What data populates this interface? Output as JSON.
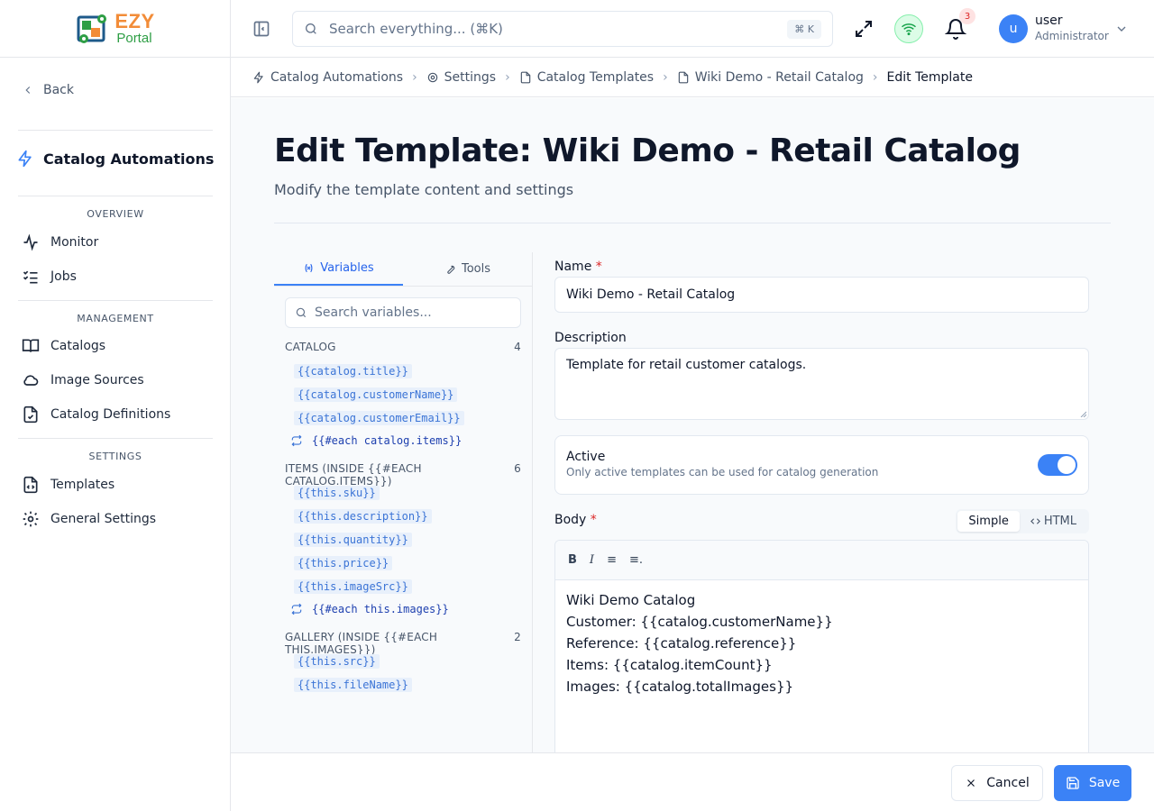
{
  "brand": {
    "line1": "EZY",
    "line2": "Portal"
  },
  "sidebar": {
    "back_label": "Back",
    "app_title": "Catalog Automations",
    "sections": [
      {
        "title": "OVERVIEW",
        "items": [
          {
            "label": "Monitor",
            "icon": "activity-icon"
          },
          {
            "label": "Jobs",
            "icon": "list-checks-icon"
          }
        ]
      },
      {
        "title": "MANAGEMENT",
        "items": [
          {
            "label": "Catalogs",
            "icon": "book-open-icon"
          },
          {
            "label": "Image Sources",
            "icon": "cloud-icon"
          },
          {
            "label": "Catalog Definitions",
            "icon": "file-check-icon"
          }
        ]
      },
      {
        "title": "SETTINGS",
        "items": [
          {
            "label": "Templates",
            "icon": "file-code-icon"
          },
          {
            "label": "General Settings",
            "icon": "gear-icon"
          }
        ]
      }
    ]
  },
  "topbar": {
    "search_placeholder": "Search everything... (⌘K)",
    "search_shortcut": "⌘ K",
    "notification_count": "3",
    "avatar_initial": "u",
    "user_name": "user",
    "user_role": "Administrator"
  },
  "breadcrumb": [
    {
      "label": "Catalog Automations",
      "icon": "zap-icon"
    },
    {
      "label": "Settings",
      "icon": "gear-icon"
    },
    {
      "label": "Catalog Templates",
      "icon": "file-code-icon"
    },
    {
      "label": "Wiki Demo - Retail Catalog",
      "icon": "file-code-icon"
    },
    {
      "label": "Edit Template"
    }
  ],
  "page": {
    "title": "Edit Template: Wiki Demo - Retail Catalog",
    "subtitle": "Modify the template content and settings"
  },
  "variables_panel": {
    "tabs": [
      {
        "label": "Variables",
        "icon": "variable-icon"
      },
      {
        "label": "Tools",
        "icon": "wrench-icon"
      }
    ],
    "search_placeholder": "Search variables...",
    "groups": [
      {
        "name": "CATALOG",
        "count": "4",
        "vars": [
          "{{catalog.title}}",
          "{{catalog.customerName}}",
          "{{catalog.customerEmail}}"
        ],
        "each": "{{#each catalog.items}}"
      },
      {
        "name": "ITEMS (INSIDE {{#EACH CATALOG.ITEMS}})",
        "count": "6",
        "vars": [
          "{{this.sku}}",
          "{{this.description}}",
          "{{this.quantity}}",
          "{{this.price}}",
          "{{this.imageSrc}}"
        ],
        "each": "{{#each this.images}}"
      },
      {
        "name": "GALLERY (INSIDE {{#EACH THIS.IMAGES}})",
        "count": "2",
        "vars": [
          "{{this.src}}",
          "{{this.fileName}}"
        ]
      }
    ]
  },
  "form": {
    "name_label": "Name",
    "name_value": "Wiki Demo - Retail Catalog",
    "description_label": "Description",
    "description_value": "Template for retail customer catalogs.",
    "active_title": "Active",
    "active_desc": "Only active templates can be used for catalog generation",
    "active_on": true,
    "body_label": "Body",
    "mode_simple": "Simple",
    "mode_html": "HTML",
    "toolbar": [
      "B",
      "I",
      "≡",
      "≡."
    ],
    "body_lines": [
      "Wiki Demo Catalog",
      "Customer: {{catalog.customerName}}",
      "Reference: {{catalog.reference}}",
      "Items: {{catalog.itemCount}}",
      "Images: {{catalog.totalImages}}"
    ]
  },
  "footer": {
    "cancel_label": "Cancel",
    "save_label": "Save"
  },
  "colors": {
    "accent": "#3b82f6",
    "brand_orange": "#f28c38",
    "brand_green": "#2e9e45"
  }
}
